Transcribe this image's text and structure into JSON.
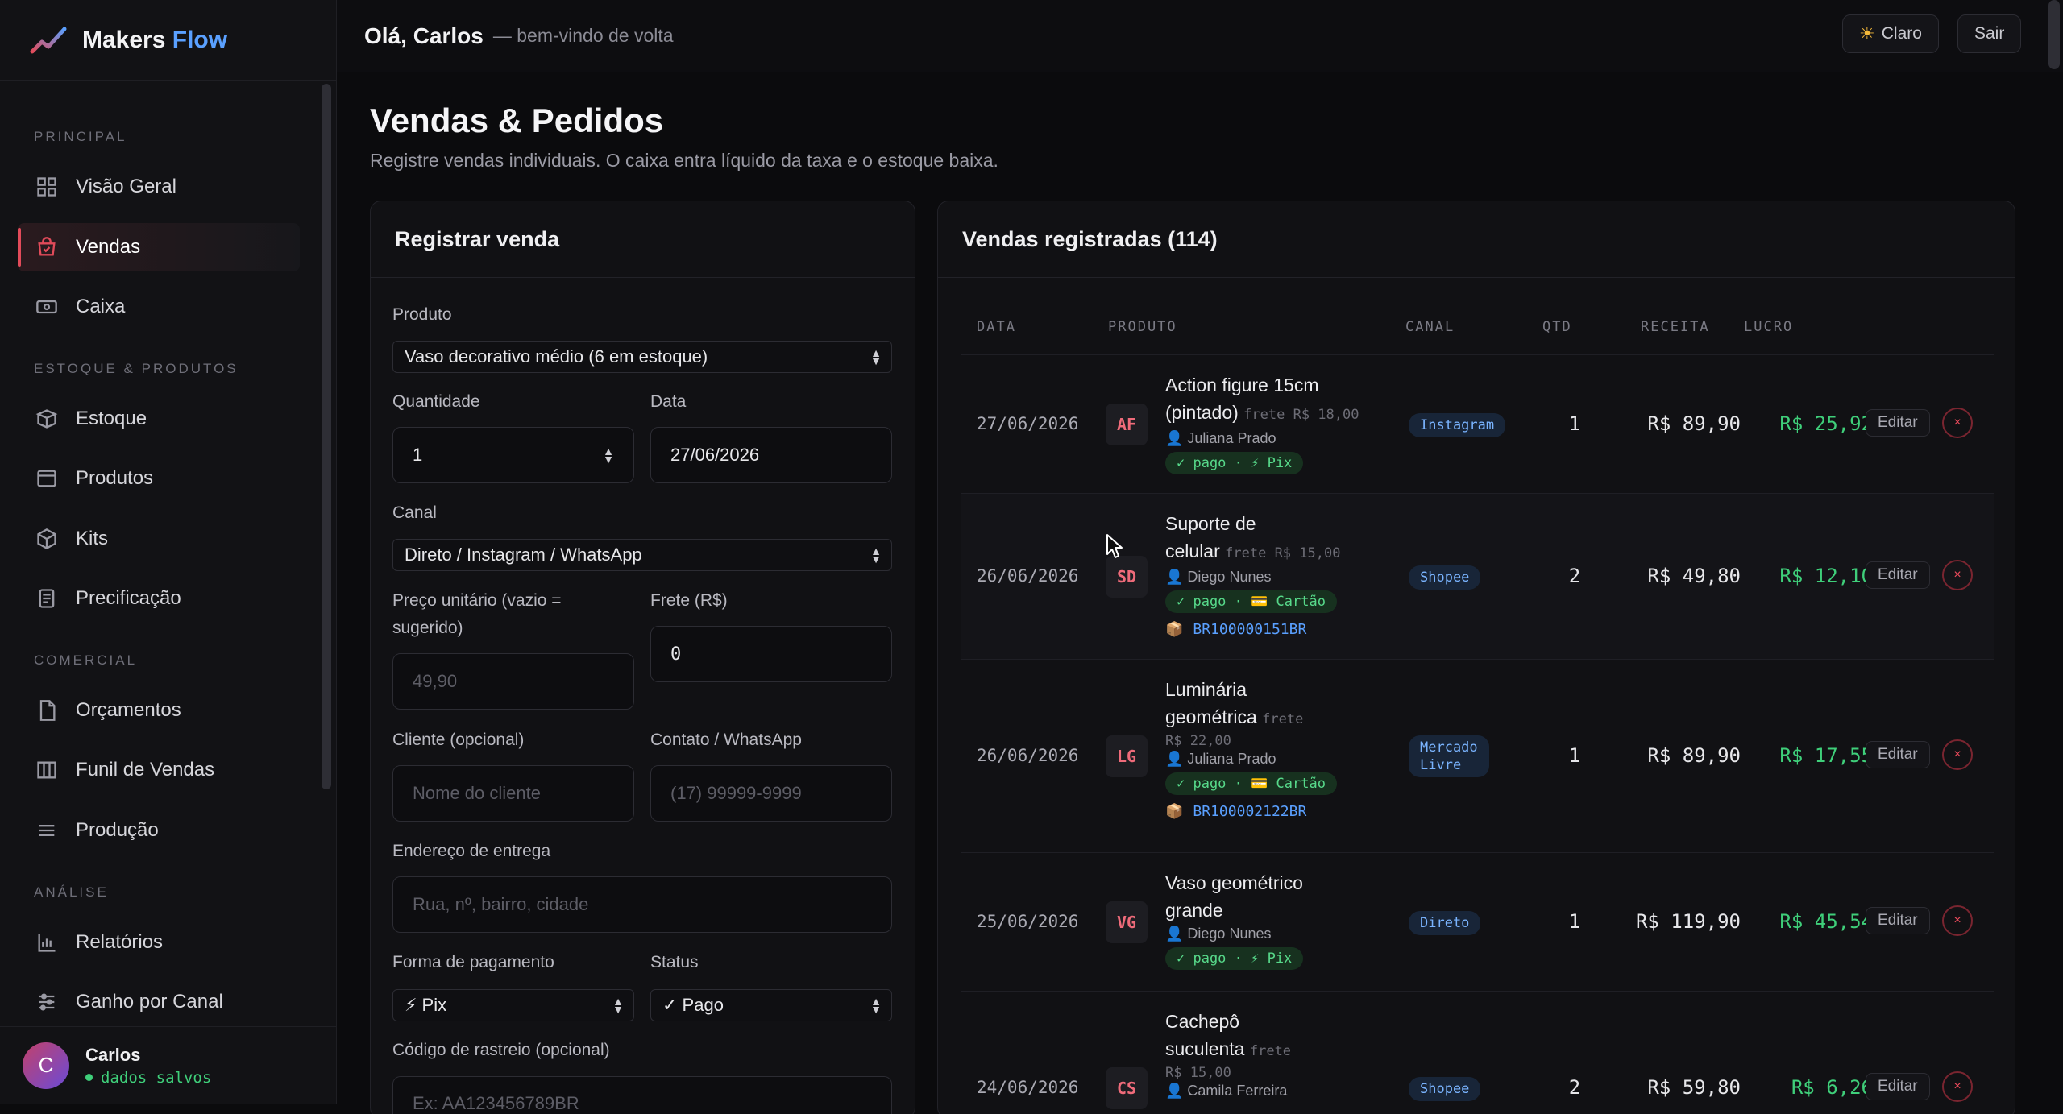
{
  "brand": {
    "name_a": "Makers",
    "name_b": "Flow"
  },
  "sidebar": {
    "sections": {
      "principal": "PRINCIPAL",
      "estoque": "ESTOQUE & PRODUTOS",
      "comercial": "COMERCIAL",
      "analise": "ANÁLISE"
    },
    "items": {
      "visao": "Visão Geral",
      "vendas": "Vendas",
      "caixa": "Caixa",
      "estoque": "Estoque",
      "produtos": "Produtos",
      "kits": "Kits",
      "precificacao": "Precificação",
      "orcamentos": "Orçamentos",
      "funil": "Funil de Vendas",
      "producao": "Produção",
      "relatorios": "Relatórios",
      "ganho": "Ganho por Canal"
    },
    "user": {
      "initial": "C",
      "name": "Carlos",
      "status": "dados salvos"
    }
  },
  "header": {
    "greeting": "Olá, Carlos",
    "greeting_sub": "— bem-vindo de volta",
    "theme_icon": "sun-icon",
    "theme_label": "Claro",
    "logout_label": "Sair"
  },
  "page": {
    "title": "Vendas & Pedidos",
    "subtitle": "Registre vendas individuais. O caixa entra líquido da taxa e o estoque baixa."
  },
  "form": {
    "title": "Registrar venda",
    "produto_label": "Produto",
    "produto_value": "Vaso decorativo médio (6 em estoque)",
    "quantidade_label": "Quantidade",
    "quantidade_value": "1",
    "data_label": "Data",
    "data_value": "27/06/2026",
    "canal_label": "Canal",
    "canal_value": "Direto / Instagram / WhatsApp",
    "preco_label": "Preço unitário (vazio = sugerido)",
    "preco_placeholder": "49,90",
    "frete_label": "Frete (R$)",
    "frete_value": "0",
    "cliente_label": "Cliente (opcional)",
    "cliente_placeholder": "Nome do cliente",
    "contato_label": "Contato / WhatsApp",
    "contato_placeholder": "(17) 99999-9999",
    "endereco_label": "Endereço de entrega",
    "endereco_placeholder": "Rua, nº, bairro, cidade",
    "pagamento_label": "Forma de pagamento",
    "pagamento_value": "⚡ Pix",
    "status_label": "Status",
    "status_value": "✓ Pago",
    "rastreio_label": "Código de rastreio (opcional)",
    "rastreio_placeholder": "Ex: AA123456789BR"
  },
  "sales": {
    "title": "Vendas registradas (114)",
    "columns": {
      "data": "DATA",
      "produto": "PRODUTO",
      "canal": "CANAL",
      "qtd": "QTD",
      "receita": "RECEITA",
      "lucro": "LUCRO"
    },
    "edit_label": "Editar",
    "delete_label": "×",
    "rows": [
      {
        "date": "27/06/2026",
        "initials": "AF",
        "name_lines": [
          "Action figure 15cm",
          "(pintado)"
        ],
        "frete": "frete R$ 18,00",
        "client": "👤 Juliana Prado",
        "status": "✓ pago · ⚡ Pix",
        "channel": "Instagram",
        "qtd": "1",
        "receita": "R$ 89,90",
        "lucro": "R$ 25,92"
      },
      {
        "date": "26/06/2026",
        "initials": "SD",
        "name_lines": [
          "Suporte de",
          "celular"
        ],
        "frete": "frete R$ 15,00",
        "client": "👤 Diego Nunes",
        "status": "✓ pago · 💳 Cartão",
        "tracking": "BR100000151BR",
        "channel": "Shopee",
        "qtd": "2",
        "receita": "R$ 49,80",
        "lucro": "R$ 12,10"
      },
      {
        "date": "26/06/2026",
        "initials": "LG",
        "name_lines": [
          "Luminária",
          "geométrica"
        ],
        "frete_a": "frete",
        "frete_b": "R$ 22,00",
        "client": "👤 Juliana Prado",
        "status": "✓ pago · 💳 Cartão",
        "tracking": "BR100002122BR",
        "channel_a": "Mercado",
        "channel_b": "Livre",
        "qtd": "1",
        "receita": "R$ 89,90",
        "lucro": "R$ 17,55"
      },
      {
        "date": "25/06/2026",
        "initials": "VG",
        "name_lines": [
          "Vaso geométrico",
          "grande"
        ],
        "client": "👤 Diego Nunes",
        "status": "✓ pago · ⚡ Pix",
        "channel": "Direto",
        "qtd": "1",
        "receita": "R$ 119,90",
        "lucro": "R$ 45,54"
      },
      {
        "date": "24/06/2026",
        "initials": "CS",
        "name_lines": [
          "Cachepô",
          "suculenta"
        ],
        "frete_a": "frete",
        "frete_b": "R$ 15,00",
        "client": "👤 Camila Ferreira",
        "channel": "Shopee",
        "qtd": "2",
        "receita": "R$ 59,80",
        "lucro": "R$ 6,26"
      }
    ]
  }
}
